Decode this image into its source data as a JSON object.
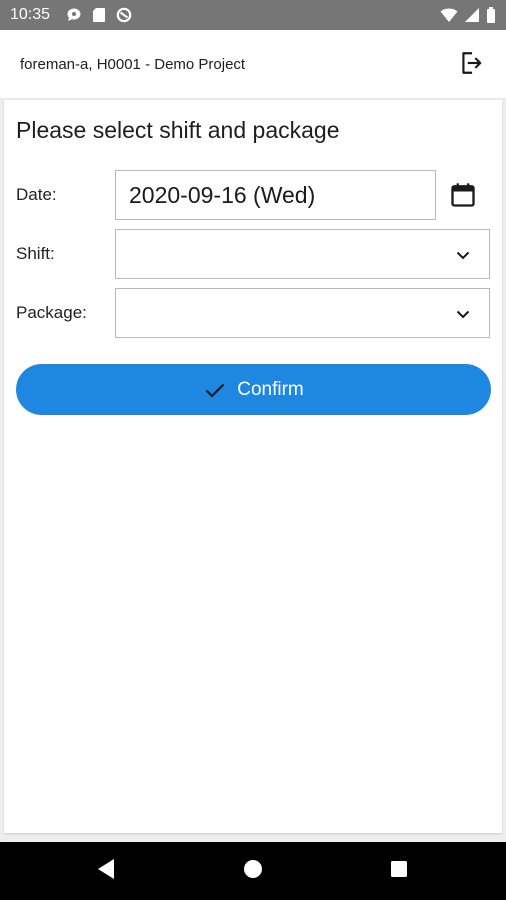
{
  "status_bar": {
    "time": "10:35",
    "left_icons": [
      "chat-bubble-icon",
      "sd-card-icon",
      "data-saver-icon"
    ],
    "right_icons": [
      "wifi-icon",
      "signal-icon",
      "battery-icon"
    ]
  },
  "app_bar": {
    "title": "foreman-a, H0001 - Demo Project",
    "logout_icon": "logout-icon"
  },
  "form": {
    "heading": "Please select shift and package",
    "date": {
      "label": "Date:",
      "value": "2020-09-16 (Wed)",
      "icon": "calendar-icon"
    },
    "shift": {
      "label": "Shift:",
      "value": "",
      "icon": "chevron-down-icon"
    },
    "package": {
      "label": "Package:",
      "value": "",
      "icon": "chevron-down-icon"
    },
    "confirm": {
      "label": "Confirm",
      "icon": "checkmark-icon"
    }
  },
  "nav_bar": {
    "buttons": [
      "back-icon",
      "home-icon",
      "recents-icon"
    ]
  },
  "colors": {
    "status_bar": "#767676",
    "accent": "#1e88e0",
    "nav_bar": "#000000"
  }
}
